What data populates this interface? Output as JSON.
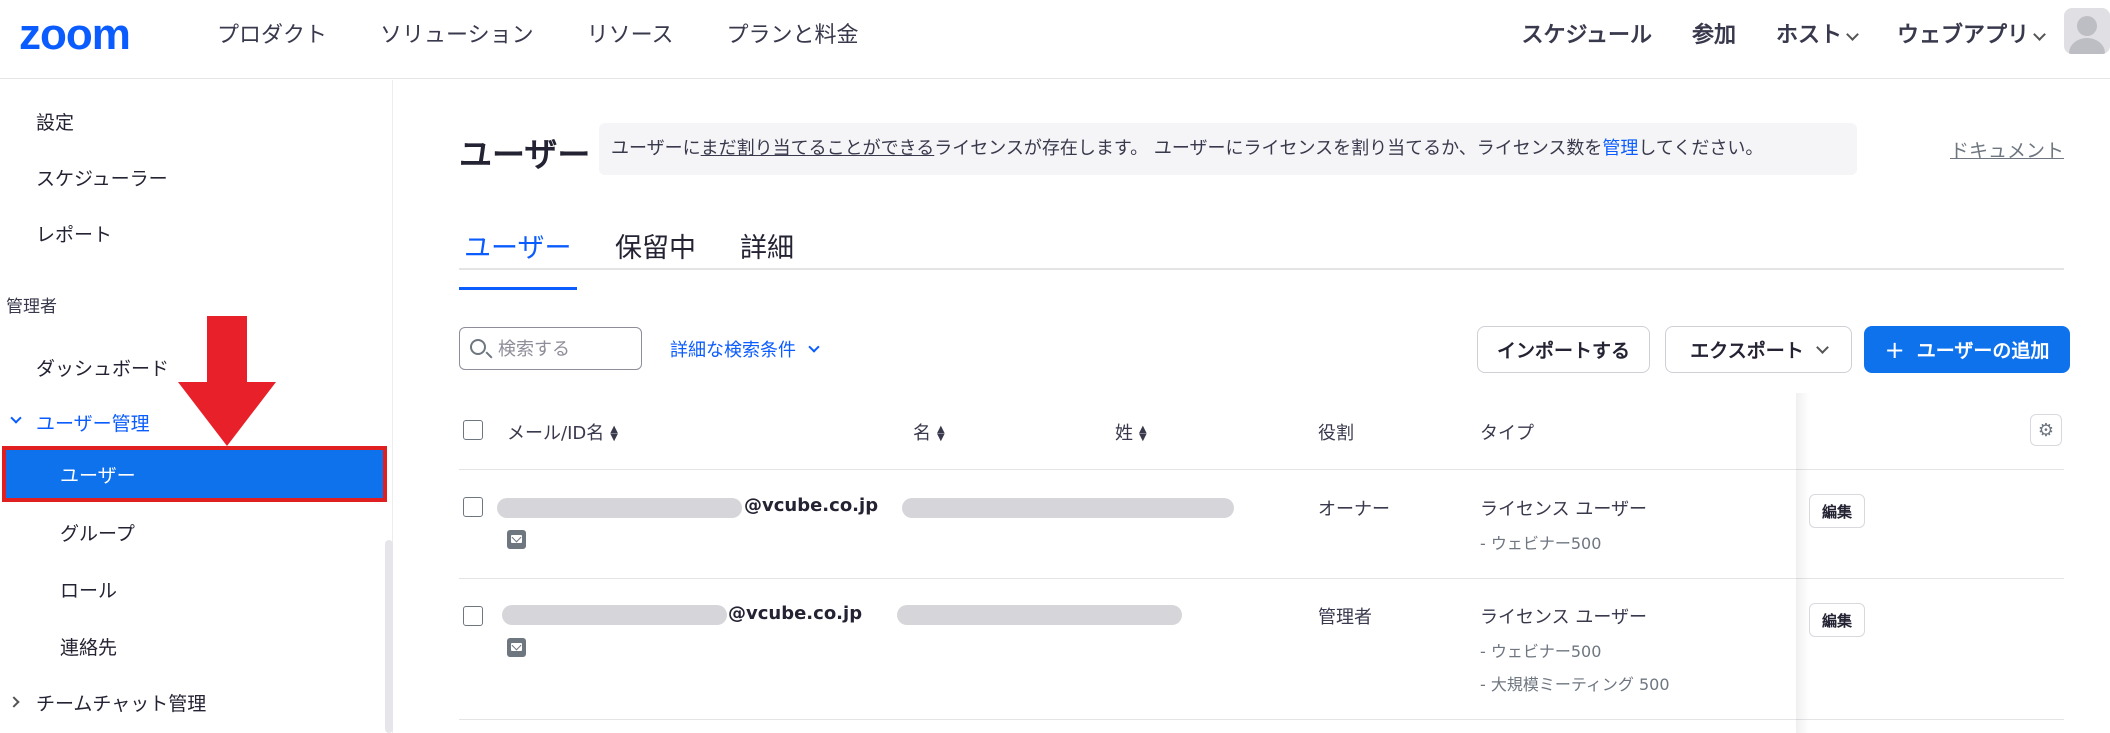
{
  "header": {
    "logo": "zoom",
    "nav_left": [
      "プロダクト",
      "ソリューション",
      "リソース",
      "プランと料金"
    ],
    "nav_right": {
      "schedule": "スケジュール",
      "join": "参加",
      "host": "ホスト",
      "web_app": "ウェブアプリ"
    }
  },
  "sidebar": {
    "items_top": [
      "設定",
      "スケジューラー",
      "レポート"
    ],
    "section_admin": "管理者",
    "dashboard": "ダッシュボード",
    "user_mgmt": "ユーザー管理",
    "active_item": "ユーザー",
    "sub_items": [
      "グループ",
      "ロール",
      "連絡先"
    ],
    "team_chat": "チームチャット管理"
  },
  "main": {
    "title": "ユーザー",
    "notice": {
      "part1": "ユーザーに",
      "underlined": "まだ割り当てることができる",
      "part2": "ライセンスが存在します。 ユーザーにライセンスを割り当てるか、ライセンス数を",
      "link": "管理",
      "part3": "してください。"
    },
    "doc_link": "ドキュメント",
    "tabs": [
      "ユーザー",
      "保留中",
      "詳細"
    ],
    "search_placeholder": "検索する",
    "advanced_search": "詳細な検索条件",
    "import_btn": "インポートする",
    "export_btn": "エクスポート",
    "add_user_btn": "ユーザーの追加",
    "table": {
      "headers": {
        "email": "メール/ID名",
        "first_name": "名",
        "last_name": "姓",
        "role": "役割",
        "type": "タイプ"
      },
      "rows": [
        {
          "email_suffix": "@vcube.co.jp",
          "role": "オーナー",
          "type": "ライセンス ユーザー",
          "type_details": [
            "- ウェビナー500"
          ],
          "edit": "編集"
        },
        {
          "email_suffix": "@vcube.co.jp",
          "role": "管理者",
          "type": "ライセンス ユーザー",
          "type_details": [
            "- ウェビナー500",
            "- 大規模ミーティング 500"
          ],
          "edit": "編集"
        }
      ]
    }
  },
  "colors": {
    "brand": "#0b5cff",
    "active_bg": "#0e72ed",
    "highlight_red": "#e02020"
  }
}
